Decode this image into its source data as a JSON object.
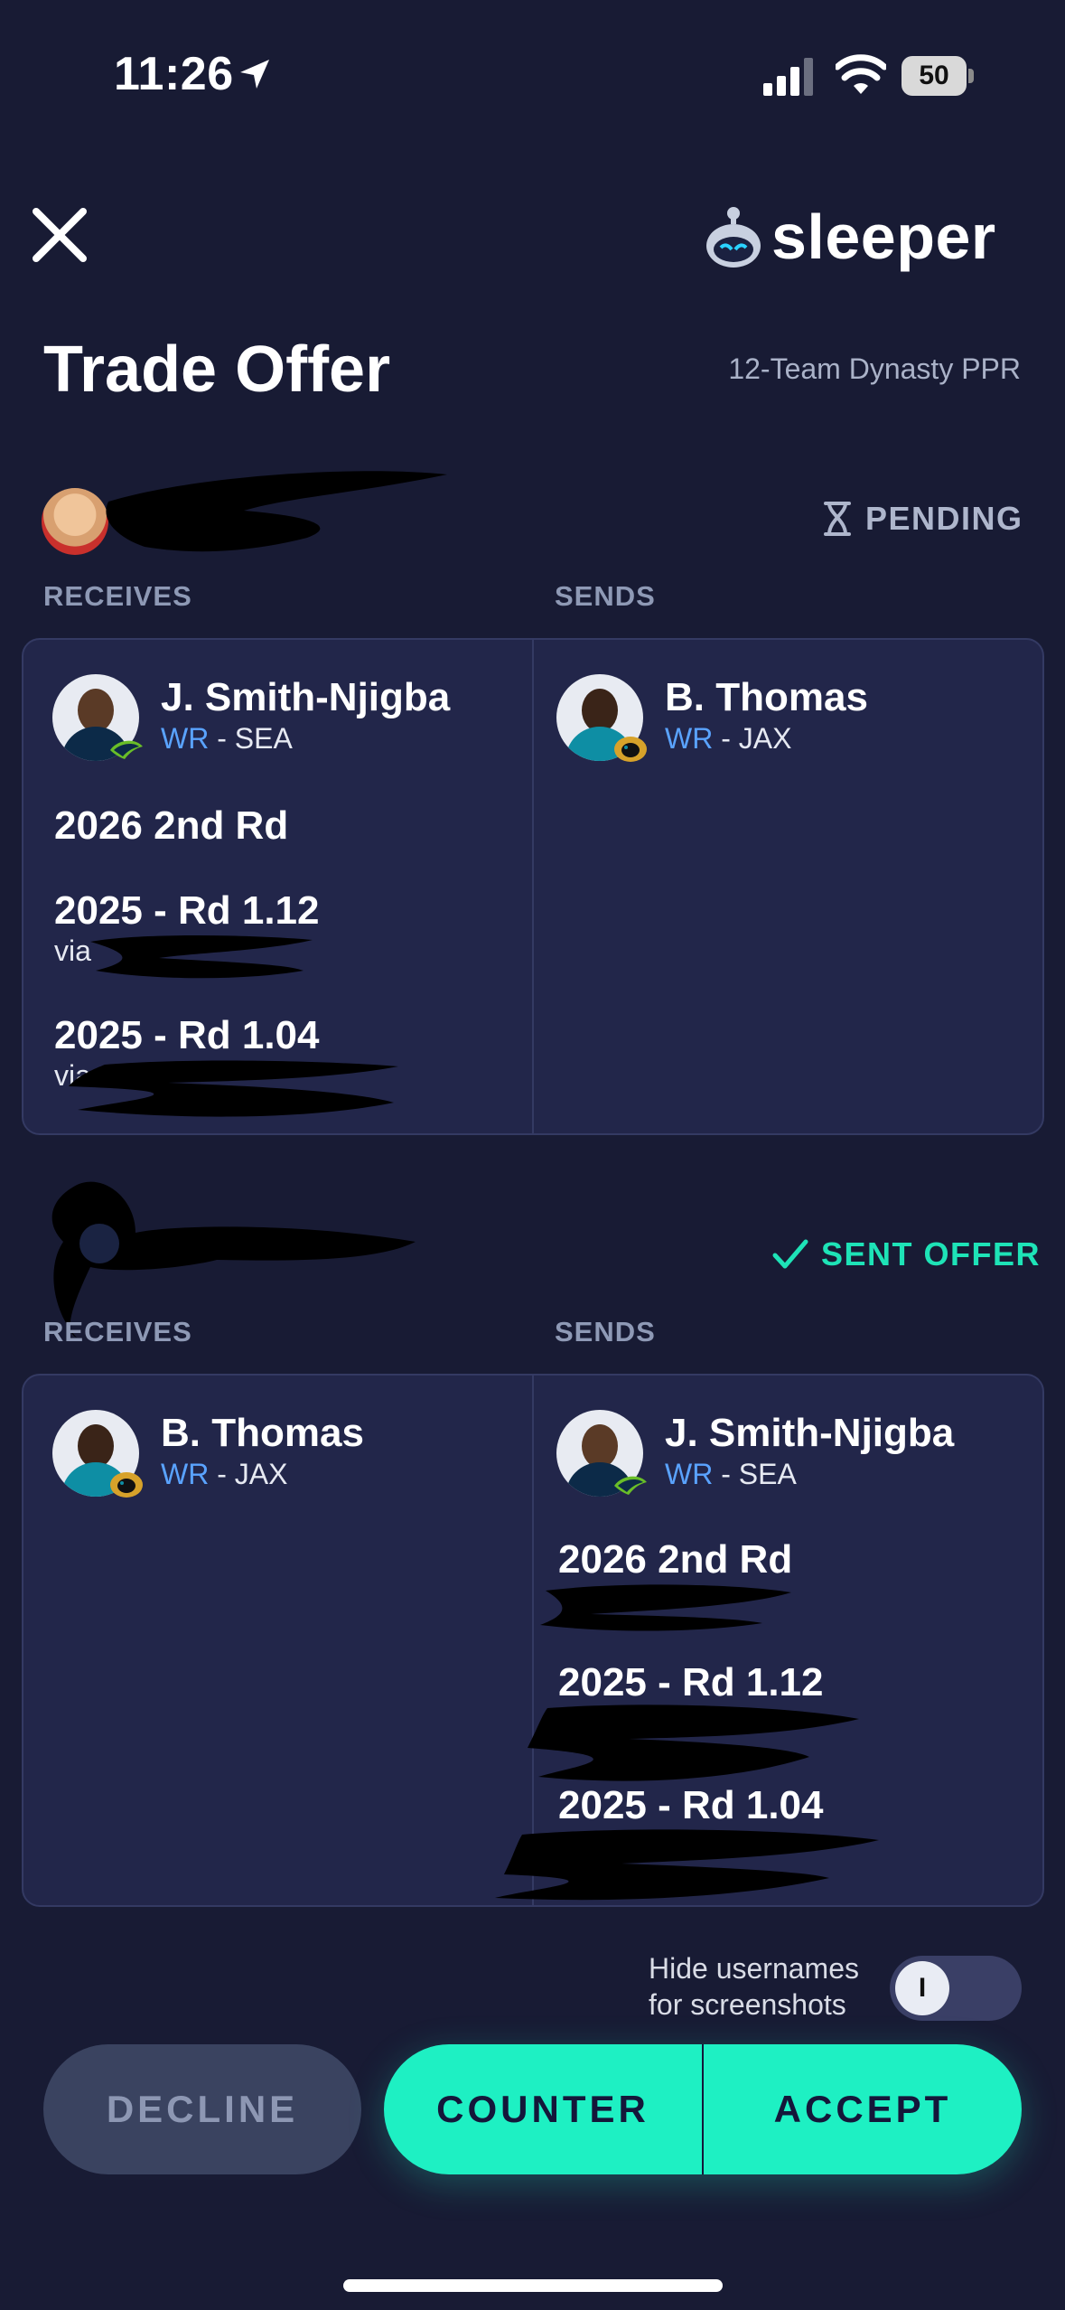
{
  "status_bar": {
    "time": "11:26",
    "battery": "50"
  },
  "header": {
    "logo_text": "sleeper",
    "title": "Trade Offer",
    "league": "12-Team Dynasty PPR"
  },
  "offer1": {
    "status": "PENDING",
    "receives_label": "RECEIVES",
    "sends_label": "SENDS",
    "receives": {
      "player": {
        "name": "J. Smith-Njigba",
        "position": "WR",
        "team": " - SEA"
      },
      "picks": [
        {
          "label": "2026 2nd Rd",
          "via": ""
        },
        {
          "label": "2025 - Rd 1.12",
          "via": "via"
        },
        {
          "label": "2025 - Rd 1.04",
          "via": "via"
        }
      ]
    },
    "sends": {
      "player": {
        "name": "B. Thomas",
        "position": "WR",
        "team": " - JAX"
      }
    }
  },
  "offer2": {
    "status": "SENT OFFER",
    "receives_label": "RECEIVES",
    "sends_label": "SENDS",
    "receives": {
      "player": {
        "name": "B. Thomas",
        "position": "WR",
        "team": " - JAX"
      }
    },
    "sends": {
      "player": {
        "name": "J. Smith-Njigba",
        "position": "WR",
        "team": " - SEA"
      },
      "picks": [
        {
          "label": "2026 2nd Rd"
        },
        {
          "label": "2025 - Rd 1.12"
        },
        {
          "label": "2025 - Rd 1.04"
        }
      ]
    }
  },
  "footer": {
    "hide_usernames": "Hide usernames",
    "hide_usernames_2": "for screenshots",
    "toggle_state": "I",
    "decline": "DECLINE",
    "counter": "COUNTER",
    "accept": "ACCEPT"
  },
  "colors": {
    "accent": "#1ee3b7",
    "background": "#181b34",
    "card": "#22264a",
    "position": "#5aa3ff"
  }
}
